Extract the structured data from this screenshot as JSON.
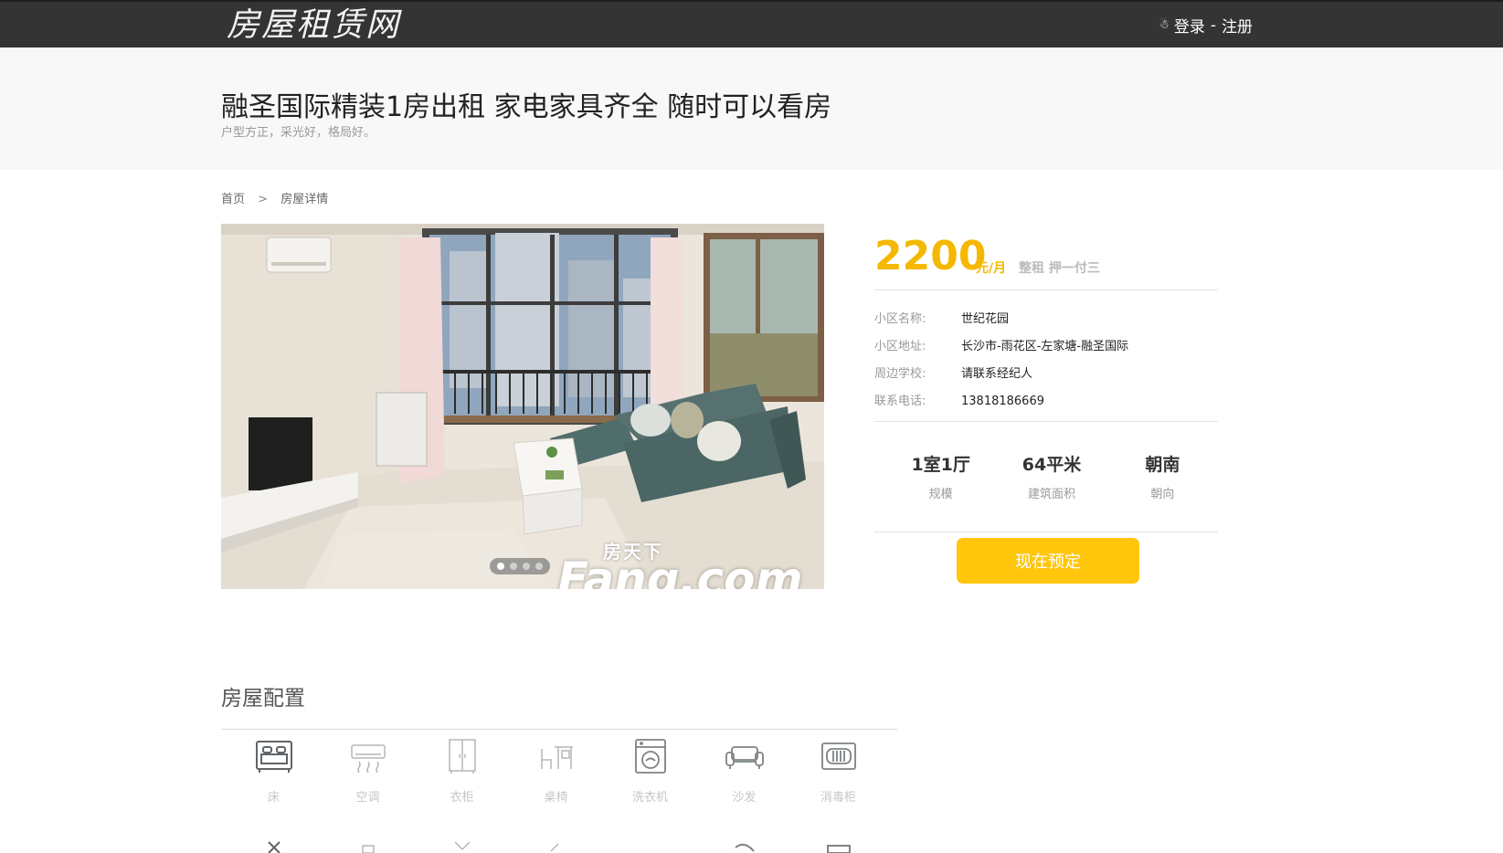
{
  "header": {
    "logo": "房屋租赁网",
    "login": "登录",
    "separator": "-",
    "register": "注册"
  },
  "listing": {
    "title": "融圣国际精装1房出租 家电家具齐全 随时可以看房",
    "subtitle": "户型方正，采光好，格局好。"
  },
  "breadcrumb": {
    "home": "首页",
    "arrow": ">",
    "current": "房屋详情"
  },
  "photo": {
    "watermark_sub": "房天下",
    "watermark_main": "Fang.com",
    "slide_count": 4,
    "active_slide": 1
  },
  "pricing": {
    "price": "2200",
    "unit": "元/月",
    "rent_type": "整租 押一付三"
  },
  "details": [
    {
      "label": "小区名称:",
      "value": "世纪花园"
    },
    {
      "label": "小区地址:",
      "value": "长沙市-雨花区-左家塘-融圣国际"
    },
    {
      "label": "周边学校:",
      "value": "请联系经纪人"
    },
    {
      "label": "联系电话:",
      "value": "13818186669"
    }
  ],
  "stats": [
    {
      "value": "1室1厅",
      "label": "规模"
    },
    {
      "value": "64平米",
      "label": "建筑面积"
    },
    {
      "value": "朝南",
      "label": "朝向"
    }
  ],
  "book_button": "现在预定",
  "config": {
    "title": "房屋配置",
    "items": [
      {
        "icon": "bed-icon",
        "label": "床"
      },
      {
        "icon": "air-conditioner-icon",
        "label": "空调"
      },
      {
        "icon": "wardrobe-icon",
        "label": "衣柜"
      },
      {
        "icon": "desk-chair-icon",
        "label": "桌椅"
      },
      {
        "icon": "washing-machine-icon",
        "label": "洗衣机"
      },
      {
        "icon": "sofa-icon",
        "label": "沙发"
      },
      {
        "icon": "disinfection-cabinet-icon",
        "label": "消毒柜"
      }
    ]
  },
  "colors": {
    "topbar": "#343434",
    "accent": "#ffc60c",
    "price": "#f5b800"
  }
}
